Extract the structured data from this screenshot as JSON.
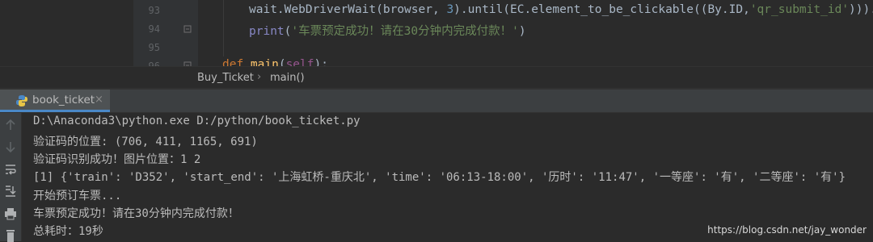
{
  "editor": {
    "line_numbers": [
      "93",
      "94",
      "95",
      "96"
    ],
    "line93": {
      "a": "wait.WebDriverWait(browser, ",
      "num": "3",
      "b": ").until(EC.element_to_be_clickable((By.ID,",
      "str": "'qr_submit_id'",
      "c": "))).cl"
    },
    "line94": {
      "fn": "print",
      "a": "(",
      "str": "'车票预定成功！请在30分钟内完成付款！'",
      "b": ")"
    },
    "line96": {
      "kw": "def ",
      "fn": "main",
      "a": "(",
      "self": "self",
      "b": "):"
    }
  },
  "breadcrumb": {
    "items": [
      "Buy_Ticket",
      "main()"
    ],
    "separator": "›"
  },
  "run_panel": {
    "tab_label": "book_ticket",
    "close_glyph": "×"
  },
  "console": {
    "lines": [
      "D:\\Anaconda3\\python.exe D:/python/book_ticket.py",
      "验证码的位置: (706, 411, 1165, 691)",
      "验证码识别成功！图片位置：1 2",
      "[1] {'train': 'D352', 'start_end': '上海虹桥-重庆北', 'time': '06:13-18:00', '历时': '11:47', '一等座': '有', '二等座': '有'}",
      "开始预订车票...",
      "车票预定成功！请在30分钟内完成付款！",
      "总耗时：19秒"
    ]
  },
  "toolbar_icons": [
    "arrow-up-icon",
    "arrow-down-icon",
    "soft-wrap-icon",
    "scroll-to-end-icon",
    "print-icon",
    "trash-icon"
  ],
  "watermark": "https://blog.csdn.net/jay_wonder",
  "colors": {
    "keyword": "#cc7832",
    "string": "#6a8759",
    "number": "#6897bb",
    "function": "#ffc66d",
    "self": "#94558d",
    "text": "#a9b7c6",
    "tab_accent": "#4a88c7"
  }
}
